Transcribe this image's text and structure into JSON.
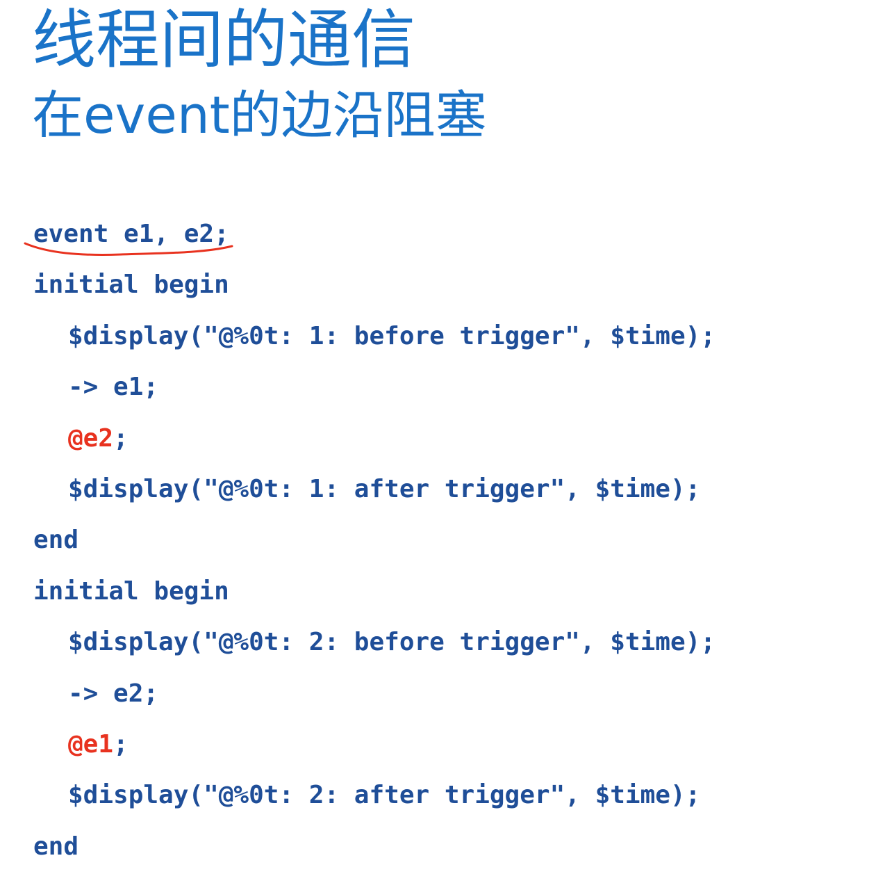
{
  "slide": {
    "title": "线程间的通信",
    "subtitle": "在event的边沿阻塞"
  },
  "code": {
    "decl": {
      "main": "event e1, e2",
      "end": ";"
    },
    "block1": {
      "begin": "initial begin",
      "display_before": "$display(\"@%0t: 1: before trigger\", $time);",
      "trigger": "-> e1;",
      "wait_event": "@e2",
      "wait_end": ";",
      "display_after": "$display(\"@%0t: 1: after trigger\", $time);",
      "end": "end"
    },
    "block2": {
      "begin": "initial begin",
      "display_before": "$display(\"@%0t: 2: before trigger\", $time);",
      "trigger": "-> e2;",
      "wait_event": "@e1",
      "wait_end": ";",
      "display_after": "$display(\"@%0t: 2: after trigger\", $time);",
      "end": "end"
    }
  },
  "colors": {
    "title": "#1a73c8",
    "code": "#1f4e98",
    "highlight": "#e8321f",
    "annotation": "#e8321f"
  }
}
